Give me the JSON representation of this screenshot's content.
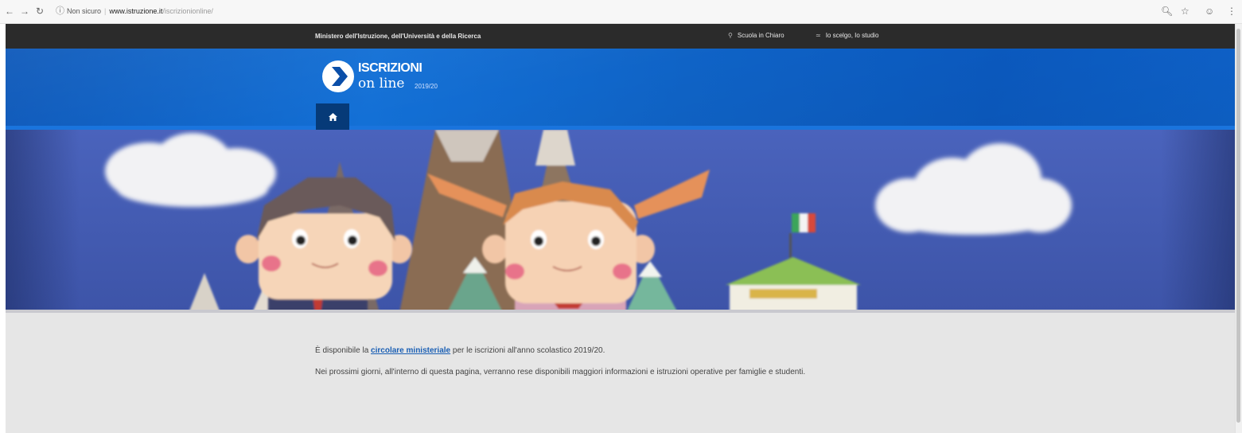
{
  "browser": {
    "back_icon": "back-arrow-icon",
    "forward_icon": "forward-arrow-icon",
    "reload_icon": "reload-icon",
    "info_icon": "info-icon",
    "security_label": "Non sicuro",
    "url_domain": "www.istruzione.it",
    "url_path": "/iscrizionionline/",
    "zoom_icon": "zoom-icon",
    "bookmark_icon": "star-icon",
    "profile_icon": "profile-icon",
    "menu_icon": "kebab-menu-icon"
  },
  "topbar": {
    "ministry": "Ministero dell'Istruzione, dell'Università e della Ricerca",
    "link1": "Scuola in Chiaro",
    "link2": "Io scelgo, Io studio"
  },
  "header": {
    "logo_line1": "ISCRIZIONI",
    "logo_line2": "on line",
    "logo_year": "2019/20",
    "home_icon": "home-icon"
  },
  "colors": {
    "header_blue": "#0f63c6",
    "topbar": "#2b2b2b",
    "home_button": "#063a78",
    "link": "#1a5fb4",
    "sky": "#4560b8"
  },
  "content": {
    "p1_before": "È disponibile la",
    "p1_link": "circolare ministeriale",
    "p1_after": "per le iscrizioni all'anno scolastico 2019/20.",
    "p2": "Nei prossimi giorni, all'interno di questa pagina, verranno rese disponibili maggiori informazioni e istruzioni operative per famiglie e studenti."
  }
}
